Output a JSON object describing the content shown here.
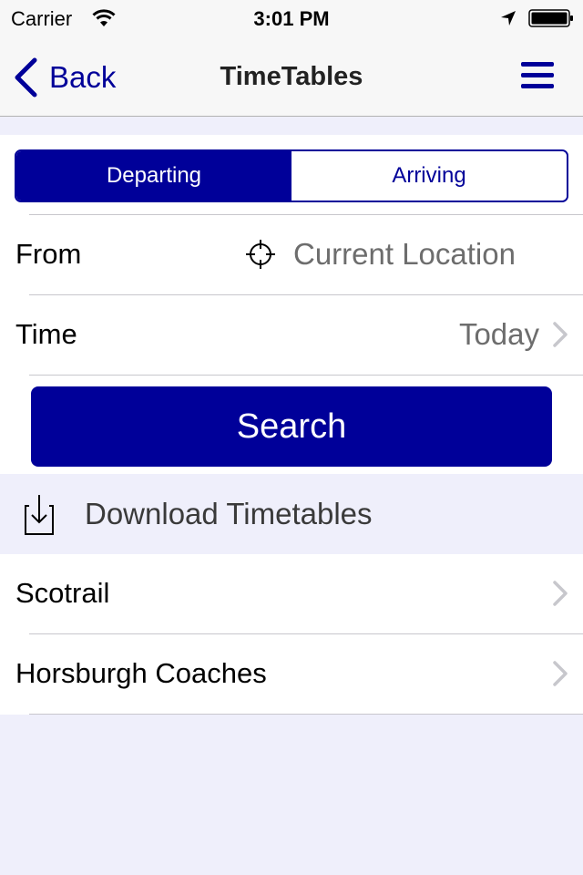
{
  "status_bar": {
    "carrier": "Carrier",
    "time": "3:01 PM",
    "icons": [
      "wifi-icon",
      "location-arrow-icon",
      "battery-icon"
    ]
  },
  "nav": {
    "back_label": "Back",
    "title": "TimeTables",
    "menu_icon": "hamburger-menu-icon"
  },
  "colors": {
    "accent": "#000099",
    "background": "#efeffb",
    "secondary_text": "#6d6d6d",
    "separator": "#c8c7cc"
  },
  "segmented_control": {
    "selected": "Departing",
    "options": [
      "Departing",
      "Arriving"
    ]
  },
  "form": {
    "from": {
      "label": "From",
      "value": "Current Location",
      "icon": "crosshair-icon"
    },
    "time": {
      "label": "Time",
      "value": "Today",
      "icon": "chevron-right-icon"
    },
    "search_label": "Search"
  },
  "downloads": {
    "header": "Download Timetables",
    "icon": "download-icon",
    "items": [
      {
        "label": "Scotrail"
      },
      {
        "label": "Horsburgh Coaches"
      }
    ]
  }
}
